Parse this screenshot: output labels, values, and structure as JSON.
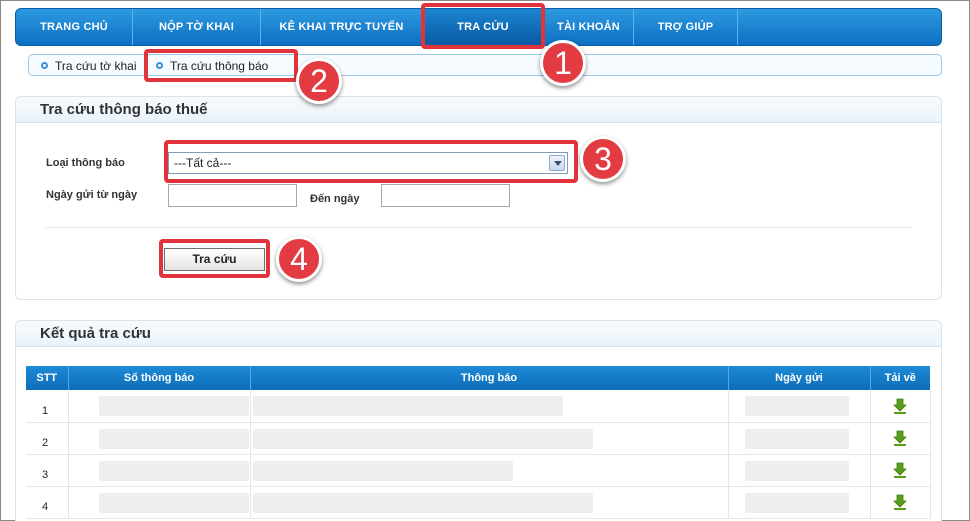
{
  "nav": {
    "items": [
      "TRANG CHỦ",
      "NỘP TỜ KHAI",
      "KÊ KHAI TRỰC TUYẾN",
      "TRA CỨU",
      "TÀI KHOẢN",
      "TRỢ GIÚP"
    ],
    "active": "TRA CỨU"
  },
  "subnav": {
    "items": [
      "Tra cứu tờ khai",
      "Tra cứu thông báo"
    ]
  },
  "search_panel": {
    "title": "Tra cứu thông báo thuế",
    "type_label": "Loại thông báo",
    "type_value": "---Tất cả---",
    "from_label": "Ngày gửi từ ngày",
    "to_label": "Đến ngày",
    "from_value": "",
    "to_value": "",
    "search_button": "Tra cứu"
  },
  "results_panel": {
    "title": "Kết quả tra cứu",
    "columns": [
      "STT",
      "Số thông báo",
      "Thông báo",
      "Ngày gửi",
      "Tải về"
    ],
    "rows": [
      "1",
      "2",
      "3",
      "4"
    ]
  },
  "annotations": [
    "1",
    "2",
    "3",
    "4"
  ],
  "colors": {
    "nav_blue": "#0d6fc2",
    "header_blue": "#1e8ad6",
    "highlight_red": "#e0333c",
    "download_green": "#5a9e1c"
  }
}
